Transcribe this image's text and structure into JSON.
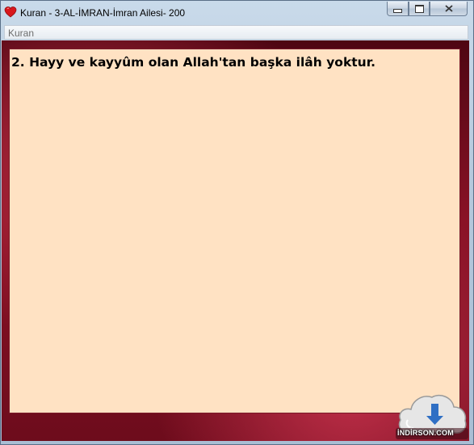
{
  "window": {
    "title": "Kuran - 3-AL-İMRAN-İmran Ailesi- 200",
    "icon": "heart-icon",
    "controls": {
      "minimize": "minimize-icon",
      "maximize": "maximize-icon",
      "close": "close-icon"
    }
  },
  "menu": {
    "items": [
      {
        "label": "Kuran"
      }
    ]
  },
  "content": {
    "verse_text": "2. Hayy ve kayyûm olan Allah'tan başka ilâh yoktur."
  },
  "watermark": {
    "text": "İNDİRSON.COM",
    "icon": "cloud-download-icon"
  },
  "colors": {
    "text_pane_bg": "#ffe2c3",
    "frame_bg": "#8a1226",
    "heart": "#d8171c"
  }
}
